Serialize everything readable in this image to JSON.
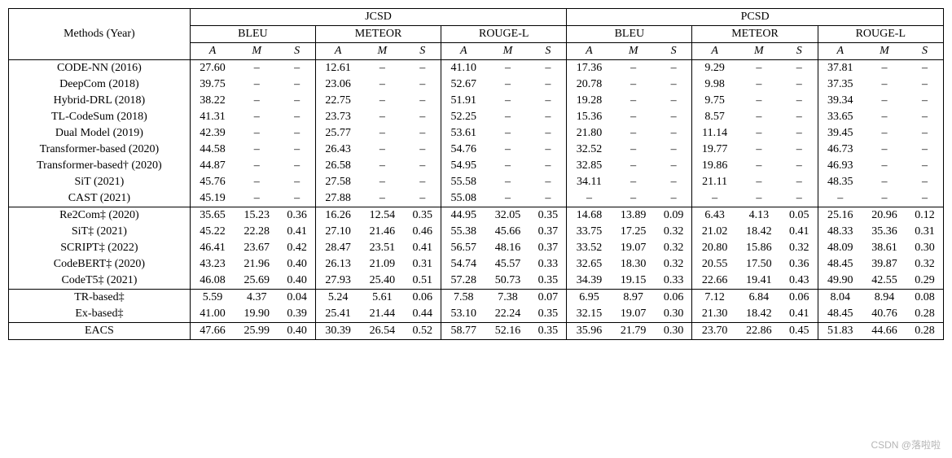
{
  "header": {
    "methods_label": "Methods (Year)",
    "datasets": [
      "JCSD",
      "PCSD"
    ],
    "metrics": [
      "BLEU",
      "METEOR",
      "ROUGE-L"
    ],
    "sub_cols": [
      "A",
      "M",
      "S"
    ]
  },
  "chart_data": [
    {
      "type": "table",
      "title": "JCSD",
      "columns": [
        "Method",
        "BLEU_A",
        "BLEU_M",
        "BLEU_S",
        "METEOR_A",
        "METEOR_M",
        "METEOR_S",
        "ROUGE-L_A",
        "ROUGE-L_M",
        "ROUGE-L_S"
      ]
    },
    {
      "type": "table",
      "title": "PCSD",
      "columns": [
        "Method",
        "BLEU_A",
        "BLEU_M",
        "BLEU_S",
        "METEOR_A",
        "METEOR_M",
        "METEOR_S",
        "ROUGE-L_A",
        "ROUGE-L_M",
        "ROUGE-L_S"
      ]
    }
  ],
  "groups": [
    {
      "rows": [
        {
          "method": "CODE-NN (2016)",
          "jcsd": {
            "bleu": [
              "27.60",
              "–",
              "–"
            ],
            "meteor": [
              "12.61",
              "–",
              "–"
            ],
            "rougel": [
              "41.10",
              "–",
              "–"
            ]
          },
          "pcsd": {
            "bleu": [
              "17.36",
              "–",
              "–"
            ],
            "meteor": [
              "9.29",
              "–",
              "–"
            ],
            "rougel": [
              "37.81",
              "–",
              "–"
            ]
          }
        },
        {
          "method": "DeepCom (2018)",
          "jcsd": {
            "bleu": [
              "39.75",
              "–",
              "–"
            ],
            "meteor": [
              "23.06",
              "–",
              "–"
            ],
            "rougel": [
              "52.67",
              "–",
              "–"
            ]
          },
          "pcsd": {
            "bleu": [
              "20.78",
              "–",
              "–"
            ],
            "meteor": [
              "9.98",
              "–",
              "–"
            ],
            "rougel": [
              "37.35",
              "–",
              "–"
            ]
          }
        },
        {
          "method": "Hybrid-DRL (2018)",
          "jcsd": {
            "bleu": [
              "38.22",
              "–",
              "–"
            ],
            "meteor": [
              "22.75",
              "–",
              "–"
            ],
            "rougel": [
              "51.91",
              "–",
              "–"
            ]
          },
          "pcsd": {
            "bleu": [
              "19.28",
              "–",
              "–"
            ],
            "meteor": [
              "9.75",
              "–",
              "–"
            ],
            "rougel": [
              "39.34",
              "–",
              "–"
            ]
          }
        },
        {
          "method": "TL-CodeSum (2018)",
          "jcsd": {
            "bleu": [
              "41.31",
              "–",
              "–"
            ],
            "meteor": [
              "23.73",
              "–",
              "–"
            ],
            "rougel": [
              "52.25",
              "–",
              "–"
            ]
          },
          "pcsd": {
            "bleu": [
              "15.36",
              "–",
              "–"
            ],
            "meteor": [
              "8.57",
              "–",
              "–"
            ],
            "rougel": [
              "33.65",
              "–",
              "–"
            ]
          }
        },
        {
          "method": "Dual Model (2019)",
          "jcsd": {
            "bleu": [
              "42.39",
              "–",
              "–"
            ],
            "meteor": [
              "25.77",
              "–",
              "–"
            ],
            "rougel": [
              "53.61",
              "–",
              "–"
            ]
          },
          "pcsd": {
            "bleu": [
              "21.80",
              "–",
              "–"
            ],
            "meteor": [
              "11.14",
              "–",
              "–"
            ],
            "rougel": [
              "39.45",
              "–",
              "–"
            ]
          }
        },
        {
          "method": "Transformer-based (2020)",
          "jcsd": {
            "bleu": [
              "44.58",
              "–",
              "–"
            ],
            "meteor": [
              "26.43",
              "–",
              "–"
            ],
            "rougel": [
              "54.76",
              "–",
              "–"
            ]
          },
          "pcsd": {
            "bleu": [
              "32.52",
              "–",
              "–"
            ],
            "meteor": [
              "19.77",
              "–",
              "–"
            ],
            "rougel": [
              "46.73",
              "–",
              "–"
            ]
          }
        },
        {
          "method": "Transformer-based† (2020)",
          "jcsd": {
            "bleu": [
              "44.87",
              "–",
              "–"
            ],
            "meteor": [
              "26.58",
              "–",
              "–"
            ],
            "rougel": [
              "54.95",
              "–",
              "–"
            ]
          },
          "pcsd": {
            "bleu": [
              "32.85",
              "–",
              "–"
            ],
            "meteor": [
              "19.86",
              "–",
              "–"
            ],
            "rougel": [
              "46.93",
              "–",
              "–"
            ]
          }
        },
        {
          "method": "SiT (2021)",
          "jcsd": {
            "bleu": [
              "45.76",
              "–",
              "–"
            ],
            "meteor": [
              "27.58",
              "–",
              "–"
            ],
            "rougel": [
              "55.58",
              "–",
              "–"
            ]
          },
          "pcsd": {
            "bleu": [
              "34.11",
              "–",
              "–"
            ],
            "meteor": [
              "21.11",
              "–",
              "–"
            ],
            "rougel": [
              "48.35",
              "–",
              "–"
            ]
          },
          "bold": {
            "j_bleu_a": true,
            "j_meteor_a": true,
            "j_rougel_a": true,
            "p_bleu_a": true,
            "p_meteor_a": true,
            "p_rougel_a": true
          }
        },
        {
          "method": "CAST (2021)",
          "jcsd": {
            "bleu": [
              "45.19",
              "–",
              "–"
            ],
            "meteor": [
              "27.88",
              "–",
              "–"
            ],
            "rougel": [
              "55.08",
              "–",
              "–"
            ]
          },
          "pcsd": {
            "bleu": [
              "–",
              "–",
              "–"
            ],
            "meteor": [
              "–",
              "–",
              "–"
            ],
            "rougel": [
              "–",
              "–",
              "–"
            ]
          }
        }
      ]
    },
    {
      "rows": [
        {
          "method": "Re2Com‡ (2020)",
          "jcsd": {
            "bleu": [
              "35.65",
              "15.23",
              "0.36"
            ],
            "meteor": [
              "16.26",
              "12.54",
              "0.35"
            ],
            "rougel": [
              "44.95",
              "32.05",
              "0.35"
            ]
          },
          "pcsd": {
            "bleu": [
              "14.68",
              "13.89",
              "0.09"
            ],
            "meteor": [
              "6.43",
              "4.13",
              "0.05"
            ],
            "rougel": [
              "25.16",
              "20.96",
              "0.12"
            ]
          }
        },
        {
          "method": "SiT‡ (2021)",
          "jcsd": {
            "bleu": [
              "45.22",
              "22.28",
              "0.41"
            ],
            "meteor": [
              "27.10",
              "21.46",
              "0.46"
            ],
            "rougel": [
              "55.38",
              "45.66",
              "0.37"
            ]
          },
          "pcsd": {
            "bleu": [
              "33.75",
              "17.25",
              "0.32"
            ],
            "meteor": [
              "21.02",
              "18.42",
              "0.41"
            ],
            "rougel": [
              "48.33",
              "35.36",
              "0.31"
            ]
          }
        },
        {
          "method": "SCRIPT‡ (2022)",
          "jcsd": {
            "bleu": [
              "46.41",
              "23.67",
              "0.42"
            ],
            "meteor": [
              "28.47",
              "23.51",
              "0.41"
            ],
            "rougel": [
              "56.57",
              "48.16",
              "0.37"
            ]
          },
          "pcsd": {
            "bleu": [
              "33.52",
              "19.07",
              "0.32"
            ],
            "meteor": [
              "20.80",
              "15.86",
              "0.32"
            ],
            "rougel": [
              "48.09",
              "38.61",
              "0.30"
            ]
          },
          "bold": {
            "j_bleu_a": true,
            "j_meteor_a": true
          }
        },
        {
          "method": "CodeBERT‡ (2020)",
          "jcsd": {
            "bleu": [
              "43.23",
              "21.96",
              "0.40"
            ],
            "meteor": [
              "26.13",
              "21.09",
              "0.31"
            ],
            "rougel": [
              "54.74",
              "45.57",
              "0.33"
            ]
          },
          "pcsd": {
            "bleu": [
              "32.65",
              "18.30",
              "0.32"
            ],
            "meteor": [
              "20.55",
              "17.50",
              "0.36"
            ],
            "rougel": [
              "48.45",
              "39.87",
              "0.32"
            ]
          }
        },
        {
          "method": "CodeT5‡ (2021)",
          "jcsd": {
            "bleu": [
              "46.08",
              "25.69",
              "0.40"
            ],
            "meteor": [
              "27.93",
              "25.40",
              "0.51"
            ],
            "rougel": [
              "57.28",
              "50.73",
              "0.35"
            ]
          },
          "pcsd": {
            "bleu": [
              "34.39",
              "19.15",
              "0.33"
            ],
            "meteor": [
              "22.66",
              "19.41",
              "0.43"
            ],
            "rougel": [
              "49.90",
              "42.55",
              "0.29"
            ]
          },
          "bold": {
            "j_bleu_m": true,
            "j_meteor_m": true,
            "j_rougel_a": true,
            "j_rougel_m": true,
            "p_bleu_a": true,
            "p_bleu_m": true,
            "p_meteor_a": true,
            "p_meteor_m": true,
            "p_rougel_a": true,
            "p_rougel_m": true
          }
        }
      ]
    },
    {
      "rows": [
        {
          "method": "TR-based‡",
          "jcsd": {
            "bleu": [
              "5.59",
              "4.37",
              "0.04"
            ],
            "meteor": [
              "5.24",
              "5.61",
              "0.06"
            ],
            "rougel": [
              "7.58",
              "7.38",
              "0.07"
            ]
          },
          "pcsd": {
            "bleu": [
              "6.95",
              "8.97",
              "0.06"
            ],
            "meteor": [
              "7.12",
              "6.84",
              "0.06"
            ],
            "rougel": [
              "8.04",
              "8.94",
              "0.08"
            ]
          }
        },
        {
          "method": "Ex-based‡",
          "jcsd": {
            "bleu": [
              "41.00",
              "19.90",
              "0.39"
            ],
            "meteor": [
              "25.41",
              "21.44",
              "0.44"
            ],
            "rougel": [
              "53.10",
              "22.24",
              "0.35"
            ]
          },
          "pcsd": {
            "bleu": [
              "32.15",
              "19.07",
              "0.30"
            ],
            "meteor": [
              "21.30",
              "18.42",
              "0.41"
            ],
            "rougel": [
              "48.45",
              "40.76",
              "0.28"
            ]
          },
          "bold": {
            "j_bleu_a": true,
            "j_meteor_a": true,
            "j_rougel_a": true,
            "p_bleu_a": true,
            "p_meteor_a": true,
            "p_rougel_a": true
          }
        }
      ]
    },
    {
      "rows": [
        {
          "method": "EACS",
          "jcsd": {
            "bleu": [
              "47.66",
              "25.99",
              "0.40"
            ],
            "meteor": [
              "30.39",
              "26.54",
              "0.52"
            ],
            "rougel": [
              "58.77",
              "52.16",
              "0.35"
            ]
          },
          "pcsd": {
            "bleu": [
              "35.96",
              "21.79",
              "0.30"
            ],
            "meteor": [
              "23.70",
              "22.86",
              "0.45"
            ],
            "rougel": [
              "51.83",
              "44.66",
              "0.28"
            ]
          },
          "bold_all": true
        }
      ]
    }
  ],
  "watermark": "CSDN @落啦啦"
}
